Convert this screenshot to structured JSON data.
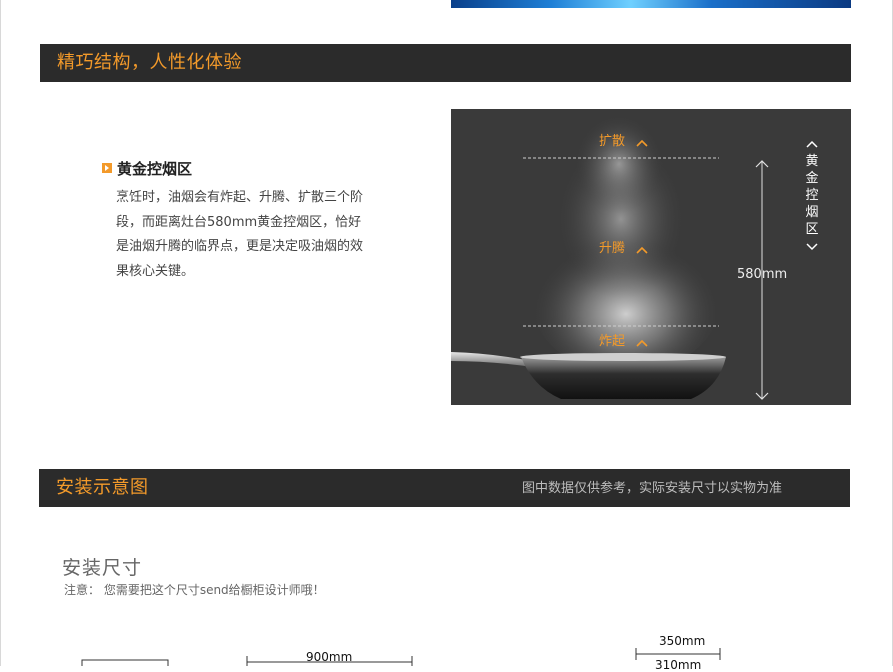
{
  "section1": {
    "title": "精巧结构，人性化体验",
    "feature": {
      "title": "黄金控烟区",
      "body": "烹饪时，油烟会有炸起、升腾、扩散三个阶段，而距离灶台580mm黄金控烟区，恰好是油烟升腾的临界点，更是决定吸油烟的效果核心关键。"
    },
    "photo": {
      "stage_spread": "扩散",
      "stage_rise": "升腾",
      "stage_fry": "炸起",
      "distance": "580mm",
      "zone_label": "黄金控烟区"
    }
  },
  "section2": {
    "title": "安装示意图",
    "note": "图中数据仅供参考，实际安装尺寸以实物为准",
    "install_title": "安装尺寸",
    "install_note": "注意： 您需要把这个尺寸send给橱柜设计师哦！",
    "dim_width": "900mm",
    "dim_top": "350mm",
    "dim_inner": "310mm"
  },
  "colors": {
    "accent": "#f39a2a",
    "bar_bg": "#2b2b2b",
    "photo_bg": "#3a3a3a"
  },
  "icons": [
    "chevron-up-icon",
    "chevron-down-icon",
    "arrow-up-icon",
    "arrow-down-icon",
    "play-bullet-icon"
  ]
}
